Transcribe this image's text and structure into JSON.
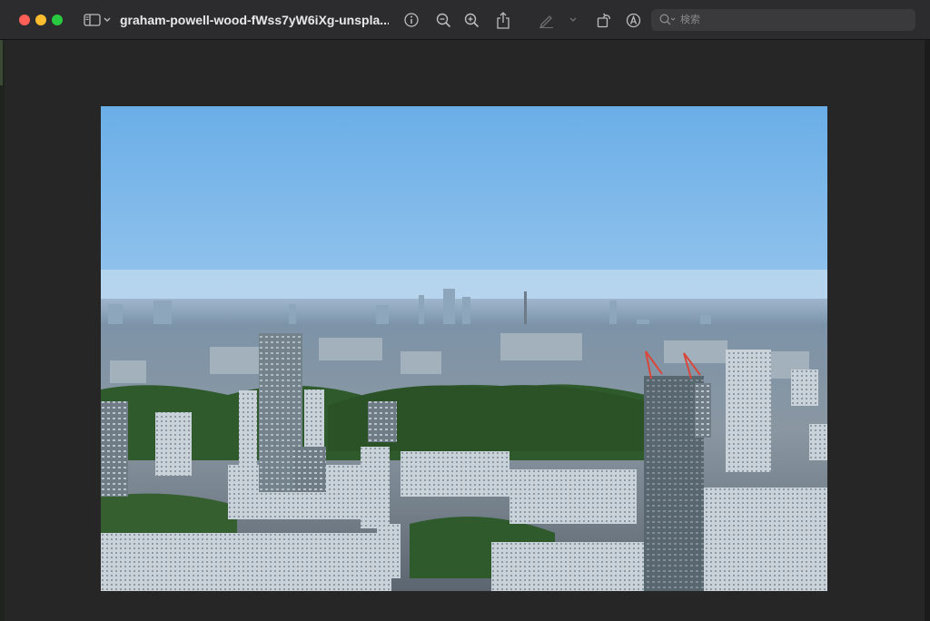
{
  "window": {
    "title": "graham-powell-wood-fWss7yW6iXg-unspla...",
    "traffic_lights": [
      "close",
      "minimize",
      "zoom"
    ]
  },
  "toolbar": {
    "sidebar_toggle_icon": "sidebar-icon",
    "sidebar_menu_icon": "chevron-down-icon",
    "info_icon": "info-circle-icon",
    "zoom_out_icon": "magnifier-minus-icon",
    "zoom_in_icon": "magnifier-plus-icon",
    "share_icon": "share-icon",
    "markup_pen_icon": "pen-icon",
    "markup_menu_icon": "chevron-down-icon",
    "rotate_icon": "rotate-icon",
    "annotate_icon": "markup-circle-icon"
  },
  "search": {
    "placeholder": "検索"
  },
  "colors": {
    "titlebar": "#2c2c2e",
    "canvas": "#262626",
    "close": "#ff5f57",
    "minimize": "#febc2e",
    "zoom": "#28c840"
  }
}
